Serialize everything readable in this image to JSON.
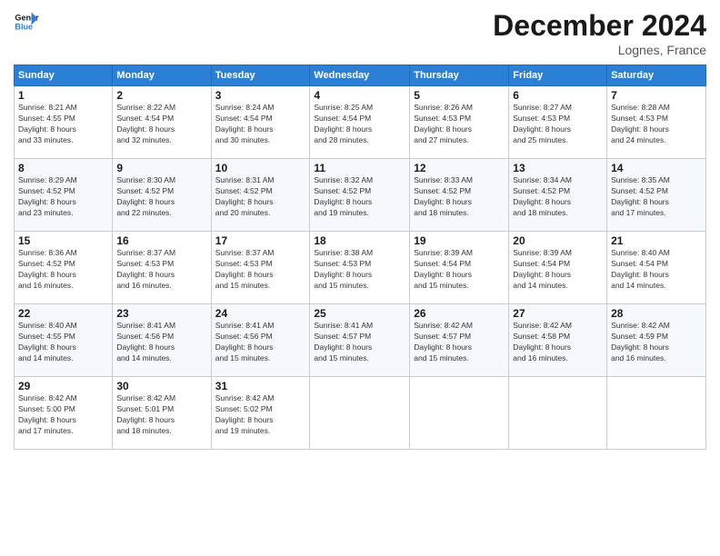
{
  "header": {
    "logo_line1": "General",
    "logo_line2": "Blue",
    "title": "December 2024",
    "location": "Lognes, France"
  },
  "weekdays": [
    "Sunday",
    "Monday",
    "Tuesday",
    "Wednesday",
    "Thursday",
    "Friday",
    "Saturday"
  ],
  "weeks": [
    [
      {
        "day": "1",
        "sunrise": "8:21 AM",
        "sunset": "4:55 PM",
        "daylight": "8 hours and 33 minutes."
      },
      {
        "day": "2",
        "sunrise": "8:22 AM",
        "sunset": "4:54 PM",
        "daylight": "8 hours and 32 minutes."
      },
      {
        "day": "3",
        "sunrise": "8:24 AM",
        "sunset": "4:54 PM",
        "daylight": "8 hours and 30 minutes."
      },
      {
        "day": "4",
        "sunrise": "8:25 AM",
        "sunset": "4:54 PM",
        "daylight": "8 hours and 28 minutes."
      },
      {
        "day": "5",
        "sunrise": "8:26 AM",
        "sunset": "4:53 PM",
        "daylight": "8 hours and 27 minutes."
      },
      {
        "day": "6",
        "sunrise": "8:27 AM",
        "sunset": "4:53 PM",
        "daylight": "8 hours and 25 minutes."
      },
      {
        "day": "7",
        "sunrise": "8:28 AM",
        "sunset": "4:53 PM",
        "daylight": "8 hours and 24 minutes."
      }
    ],
    [
      {
        "day": "8",
        "sunrise": "8:29 AM",
        "sunset": "4:52 PM",
        "daylight": "8 hours and 23 minutes."
      },
      {
        "day": "9",
        "sunrise": "8:30 AM",
        "sunset": "4:52 PM",
        "daylight": "8 hours and 22 minutes."
      },
      {
        "day": "10",
        "sunrise": "8:31 AM",
        "sunset": "4:52 PM",
        "daylight": "8 hours and 20 minutes."
      },
      {
        "day": "11",
        "sunrise": "8:32 AM",
        "sunset": "4:52 PM",
        "daylight": "8 hours and 19 minutes."
      },
      {
        "day": "12",
        "sunrise": "8:33 AM",
        "sunset": "4:52 PM",
        "daylight": "8 hours and 18 minutes."
      },
      {
        "day": "13",
        "sunrise": "8:34 AM",
        "sunset": "4:52 PM",
        "daylight": "8 hours and 18 minutes."
      },
      {
        "day": "14",
        "sunrise": "8:35 AM",
        "sunset": "4:52 PM",
        "daylight": "8 hours and 17 minutes."
      }
    ],
    [
      {
        "day": "15",
        "sunrise": "8:36 AM",
        "sunset": "4:52 PM",
        "daylight": "8 hours and 16 minutes."
      },
      {
        "day": "16",
        "sunrise": "8:37 AM",
        "sunset": "4:53 PM",
        "daylight": "8 hours and 16 minutes."
      },
      {
        "day": "17",
        "sunrise": "8:37 AM",
        "sunset": "4:53 PM",
        "daylight": "8 hours and 15 minutes."
      },
      {
        "day": "18",
        "sunrise": "8:38 AM",
        "sunset": "4:53 PM",
        "daylight": "8 hours and 15 minutes."
      },
      {
        "day": "19",
        "sunrise": "8:39 AM",
        "sunset": "4:54 PM",
        "daylight": "8 hours and 15 minutes."
      },
      {
        "day": "20",
        "sunrise": "8:39 AM",
        "sunset": "4:54 PM",
        "daylight": "8 hours and 14 minutes."
      },
      {
        "day": "21",
        "sunrise": "8:40 AM",
        "sunset": "4:54 PM",
        "daylight": "8 hours and 14 minutes."
      }
    ],
    [
      {
        "day": "22",
        "sunrise": "8:40 AM",
        "sunset": "4:55 PM",
        "daylight": "8 hours and 14 minutes."
      },
      {
        "day": "23",
        "sunrise": "8:41 AM",
        "sunset": "4:56 PM",
        "daylight": "8 hours and 14 minutes."
      },
      {
        "day": "24",
        "sunrise": "8:41 AM",
        "sunset": "4:56 PM",
        "daylight": "8 hours and 15 minutes."
      },
      {
        "day": "25",
        "sunrise": "8:41 AM",
        "sunset": "4:57 PM",
        "daylight": "8 hours and 15 minutes."
      },
      {
        "day": "26",
        "sunrise": "8:42 AM",
        "sunset": "4:57 PM",
        "daylight": "8 hours and 15 minutes."
      },
      {
        "day": "27",
        "sunrise": "8:42 AM",
        "sunset": "4:58 PM",
        "daylight": "8 hours and 16 minutes."
      },
      {
        "day": "28",
        "sunrise": "8:42 AM",
        "sunset": "4:59 PM",
        "daylight": "8 hours and 16 minutes."
      }
    ],
    [
      {
        "day": "29",
        "sunrise": "8:42 AM",
        "sunset": "5:00 PM",
        "daylight": "8 hours and 17 minutes."
      },
      {
        "day": "30",
        "sunrise": "8:42 AM",
        "sunset": "5:01 PM",
        "daylight": "8 hours and 18 minutes."
      },
      {
        "day": "31",
        "sunrise": "8:42 AM",
        "sunset": "5:02 PM",
        "daylight": "8 hours and 19 minutes."
      },
      null,
      null,
      null,
      null
    ]
  ]
}
